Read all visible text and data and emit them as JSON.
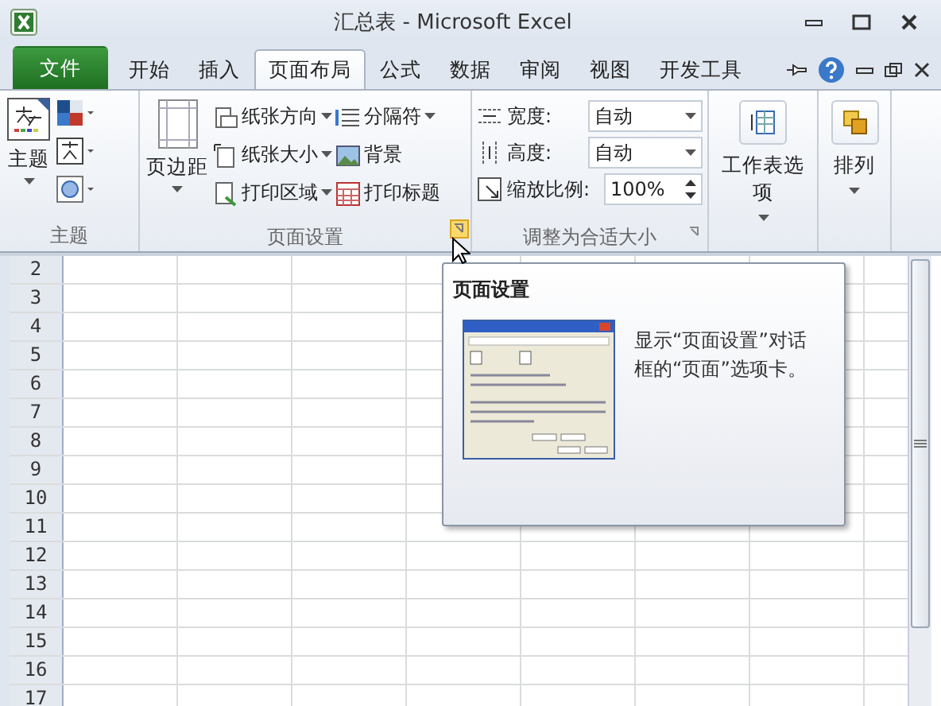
{
  "window": {
    "title": "汇总表 - Microsoft Excel"
  },
  "tabs": [
    {
      "label": "文件",
      "kind": "file",
      "selected": false
    },
    {
      "label": "开始",
      "kind": "tab",
      "selected": false
    },
    {
      "label": "插入",
      "kind": "tab",
      "selected": false
    },
    {
      "label": "页面布局",
      "kind": "tab",
      "selected": true
    },
    {
      "label": "公式",
      "kind": "tab",
      "selected": false
    },
    {
      "label": "数据",
      "kind": "tab",
      "selected": false
    },
    {
      "label": "审阅",
      "kind": "tab",
      "selected": false
    },
    {
      "label": "视图",
      "kind": "tab",
      "selected": false
    },
    {
      "label": "开发工具",
      "kind": "tab",
      "selected": false
    }
  ],
  "theme_group": {
    "label": "主题",
    "button": "主题"
  },
  "page_setup_group": {
    "label": "页面设置",
    "margins": "页边距",
    "commands": [
      {
        "label": "纸张方向",
        "dropdown": true
      },
      {
        "label": "分隔符",
        "dropdown": true
      },
      {
        "label": "纸张大小",
        "dropdown": true
      },
      {
        "label": "背景",
        "dropdown": false
      },
      {
        "label": "打印区域",
        "dropdown": true
      },
      {
        "label": "打印标题",
        "dropdown": false
      }
    ]
  },
  "scale_group": {
    "label": "调整为合适大小",
    "width": {
      "label": "宽度:",
      "value": "自动"
    },
    "height": {
      "label": "高度:",
      "value": "自动"
    },
    "scale": {
      "label": "缩放比例:",
      "value": "100%"
    }
  },
  "sheet_options": {
    "label": "工作表选项"
  },
  "arrange": {
    "label": "排列"
  },
  "rows": [
    "2",
    "3",
    "4",
    "5",
    "6",
    "7",
    "8",
    "9",
    "10",
    "11",
    "12",
    "13",
    "14",
    "15",
    "16",
    "17"
  ],
  "tooltip": {
    "title": "页面设置",
    "text": "显示“页面设置”对话框的“页面”选项卡。"
  }
}
